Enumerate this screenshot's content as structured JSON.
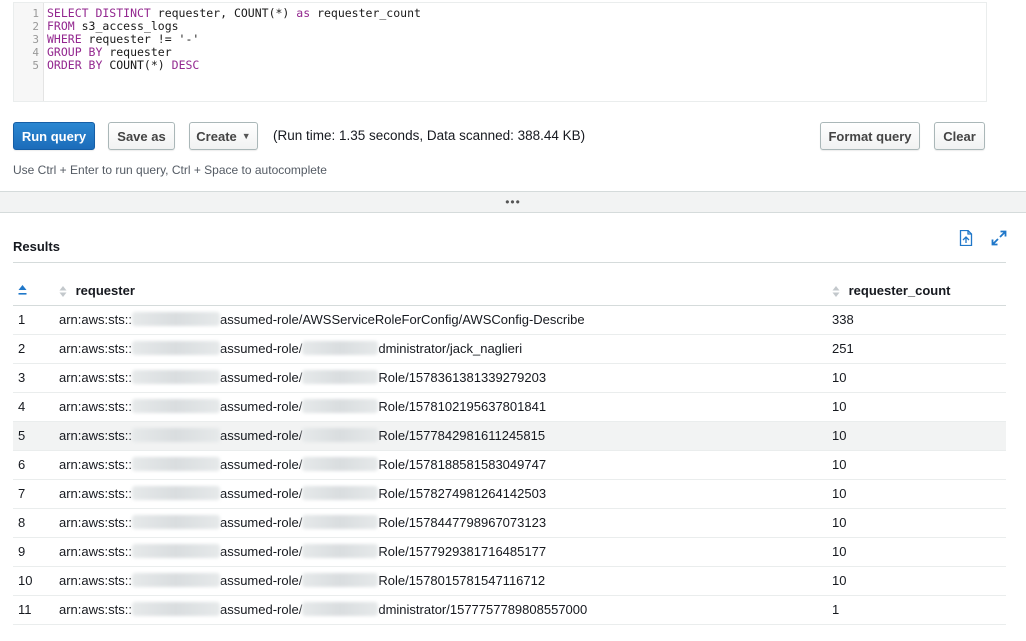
{
  "editor": {
    "line_numbers": [
      "1",
      "2",
      "3",
      "4",
      "5"
    ],
    "lines": [
      [
        {
          "t": "SELECT DISTINCT",
          "k": 1
        },
        {
          "t": " requester, ",
          "k": 0
        },
        {
          "t": "COUNT",
          "k": 0
        },
        {
          "t": "(*) ",
          "k": 0
        },
        {
          "t": "as",
          "k": 1
        },
        {
          "t": " requester_count",
          "k": 0
        }
      ],
      [
        {
          "t": "FROM",
          "k": 1
        },
        {
          "t": " s3_access_logs",
          "k": 0
        }
      ],
      [
        {
          "t": "WHERE",
          "k": 1
        },
        {
          "t": " requester != '-'",
          "k": 0
        }
      ],
      [
        {
          "t": "GROUP BY",
          "k": 1
        },
        {
          "t": " requester",
          "k": 0
        }
      ],
      [
        {
          "t": "ORDER BY",
          "k": 1
        },
        {
          "t": " COUNT(*) ",
          "k": 0
        },
        {
          "t": "DESC",
          "k": 1
        }
      ]
    ]
  },
  "toolbar": {
    "run_label": "Run query",
    "save_label": "Save as",
    "create_label": "Create",
    "runtime_text": "(Run time: 1.35 seconds, Data scanned: 388.44 KB)",
    "format_label": "Format query",
    "clear_label": "Clear"
  },
  "hint": "Use Ctrl + Enter to run query, Ctrl + Space to autocomplete",
  "results": {
    "title": "Results",
    "columns": [
      "requester",
      "requester_count"
    ],
    "rows": [
      {
        "idx": "1",
        "prefix": "arn:aws:sts::",
        "mid": "assumed-role/",
        "suffix": "AWSServiceRoleForConfig/AWSConfig-Describe",
        "blur2": false,
        "count": "338"
      },
      {
        "idx": "2",
        "prefix": "arn:aws:sts::",
        "mid": "assumed-role/",
        "suffix": "dministrator/jack_naglieri",
        "blur2": true,
        "count": "251"
      },
      {
        "idx": "3",
        "prefix": "arn:aws:sts::",
        "mid": "assumed-role/",
        "suffix": "Role/1578361381339279203",
        "blur2": true,
        "count": "10"
      },
      {
        "idx": "4",
        "prefix": "arn:aws:sts::",
        "mid": "assumed-role/",
        "suffix": "Role/1578102195637801841",
        "blur2": true,
        "count": "10"
      },
      {
        "idx": "5",
        "prefix": "arn:aws:sts::",
        "mid": "assumed-role/",
        "suffix": "Role/1577842981611245815",
        "blur2": true,
        "count": "10"
      },
      {
        "idx": "6",
        "prefix": "arn:aws:sts::",
        "mid": "assumed-role/",
        "suffix": "Role/1578188581583049747",
        "blur2": true,
        "count": "10"
      },
      {
        "idx": "7",
        "prefix": "arn:aws:sts::",
        "mid": "assumed-role/",
        "suffix": "Role/1578274981264142503",
        "blur2": true,
        "count": "10"
      },
      {
        "idx": "8",
        "prefix": "arn:aws:sts::",
        "mid": "assumed-role/",
        "suffix": "Role/1578447798967073123",
        "blur2": true,
        "count": "10"
      },
      {
        "idx": "9",
        "prefix": "arn:aws:sts::",
        "mid": "assumed-role/",
        "suffix": "Role/1577929381716485177",
        "blur2": true,
        "count": "10"
      },
      {
        "idx": "10",
        "prefix": "arn:aws:sts::",
        "mid": "assumed-role/",
        "suffix": "Role/1578015781547116712",
        "blur2": true,
        "count": "10"
      },
      {
        "idx": "11",
        "prefix": "arn:aws:sts::",
        "mid": "assumed-role/",
        "suffix": "dministrator/1577757789808557000",
        "blur2": true,
        "count": "1"
      }
    ],
    "highlighted_row": 5
  },
  "colors": {
    "primary": "#1c6cba",
    "keyword": "#93278f",
    "icon_blue": "#1f77c9"
  },
  "icons": [
    "export-csv-icon",
    "expand-icon",
    "sort-asc-icon",
    "sort-icon"
  ]
}
